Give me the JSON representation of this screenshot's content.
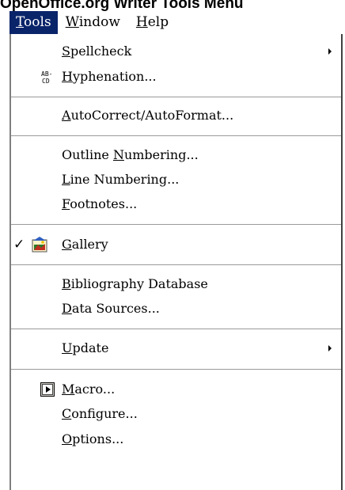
{
  "caption": "OpenOffice.org Writer Tools Menu",
  "menubar": {
    "tools": {
      "pre": "",
      "key": "T",
      "post": "ools"
    },
    "window": {
      "pre": "",
      "key": "W",
      "post": "indow"
    },
    "help": {
      "pre": "",
      "key": "H",
      "post": "elp"
    }
  },
  "items": [
    {
      "pre": "",
      "key": "S",
      "post": "pellcheck"
    },
    {
      "pre": "",
      "key": "H",
      "post": "yphenation..."
    },
    {
      "pre": "",
      "key": "A",
      "post": "utoCorrect/AutoFormat..."
    },
    {
      "pre": "Outline ",
      "key": "N",
      "post": "umbering..."
    },
    {
      "pre": "",
      "key": "L",
      "post": "ine Numbering..."
    },
    {
      "pre": "",
      "key": "F",
      "post": "ootnotes..."
    },
    {
      "pre": "",
      "key": "G",
      "post": "allery"
    },
    {
      "pre": "",
      "key": "B",
      "post": "ibliography Database"
    },
    {
      "pre": "",
      "key": "D",
      "post": "ata Sources..."
    },
    {
      "pre": "",
      "key": "U",
      "post": "pdate"
    },
    {
      "pre": "",
      "key": "M",
      "post": "acro..."
    },
    {
      "pre": "",
      "key": "C",
      "post": "onfigure..."
    },
    {
      "pre": "",
      "key": "O",
      "post": "ptions..."
    }
  ],
  "icons": {
    "hyphenation_glyph_top": "AB-",
    "hyphenation_glyph_bottom": "CD",
    "gallery_check": "✓"
  },
  "colors": {
    "highlight": "#0a246a"
  }
}
